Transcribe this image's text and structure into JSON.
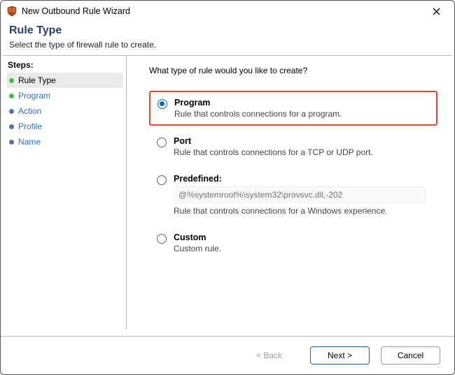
{
  "window": {
    "title": "New Outbound Rule Wizard"
  },
  "header": {
    "heading": "Rule Type",
    "subtitle": "Select the type of firewall rule to create."
  },
  "sidebar": {
    "steps_label": "Steps:",
    "items": [
      {
        "label": "Rule Type"
      },
      {
        "label": "Program"
      },
      {
        "label": "Action"
      },
      {
        "label": "Profile"
      },
      {
        "label": "Name"
      }
    ]
  },
  "main": {
    "question": "What type of rule would you like to create?",
    "options": {
      "program": {
        "title": "Program",
        "desc": "Rule that controls connections for a program."
      },
      "port": {
        "title": "Port",
        "desc": "Rule that controls connections for a TCP or UDP port."
      },
      "predefined": {
        "title": "Predefined:",
        "path": "@%systemroot%\\system32\\provsvc.dll,-202",
        "desc": "Rule that controls connections for a Windows experience."
      },
      "custom": {
        "title": "Custom",
        "desc": "Custom rule."
      }
    }
  },
  "footer": {
    "back": "< Back",
    "next": "Next >",
    "cancel": "Cancel"
  }
}
